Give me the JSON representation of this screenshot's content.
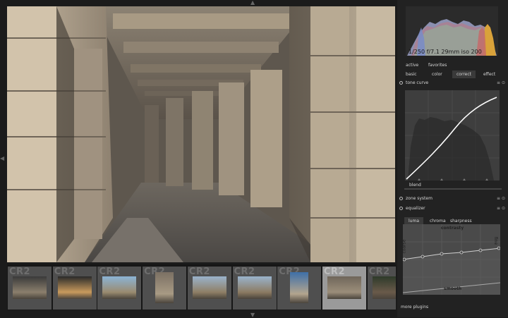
{
  "histogram": {
    "exposure_info": "1/250 f/7.1 29mm iso 200"
  },
  "module_groups": {
    "row1": [
      {
        "label": "active"
      },
      {
        "label": "favorites"
      }
    ],
    "row2": [
      {
        "label": "basic"
      },
      {
        "label": "color"
      },
      {
        "label": "correct",
        "active": true
      },
      {
        "label": "effect"
      }
    ]
  },
  "modules": {
    "tone_curve": {
      "title": "tone curve",
      "blend_label": "blend"
    },
    "zone_system": {
      "title": "zone system"
    },
    "equalizer": {
      "title": "equalizer",
      "tabs": [
        {
          "label": "luma",
          "active": true
        },
        {
          "label": "chroma"
        },
        {
          "label": "sharpness"
        }
      ],
      "graph_label_top": "contrasty",
      "graph_label_left": "coarse",
      "graph_label_right": "fine",
      "graph_label_bottom": "smooth"
    }
  },
  "more_plugins": "more plugins",
  "filmstrip": {
    "thumbs": [
      {
        "label": "CR2"
      },
      {
        "label": "CR2"
      },
      {
        "label": "CR2"
      },
      {
        "label": "CR2"
      },
      {
        "label": "CR2"
      },
      {
        "label": "CR2"
      },
      {
        "label": "CR2"
      },
      {
        "label": "CR2",
        "selected": true
      },
      {
        "label": "CR2"
      }
    ]
  },
  "colors": {
    "panel_bg": "#222222",
    "active_tab": "#3a3a3a",
    "curve_line": "#ffffff"
  }
}
